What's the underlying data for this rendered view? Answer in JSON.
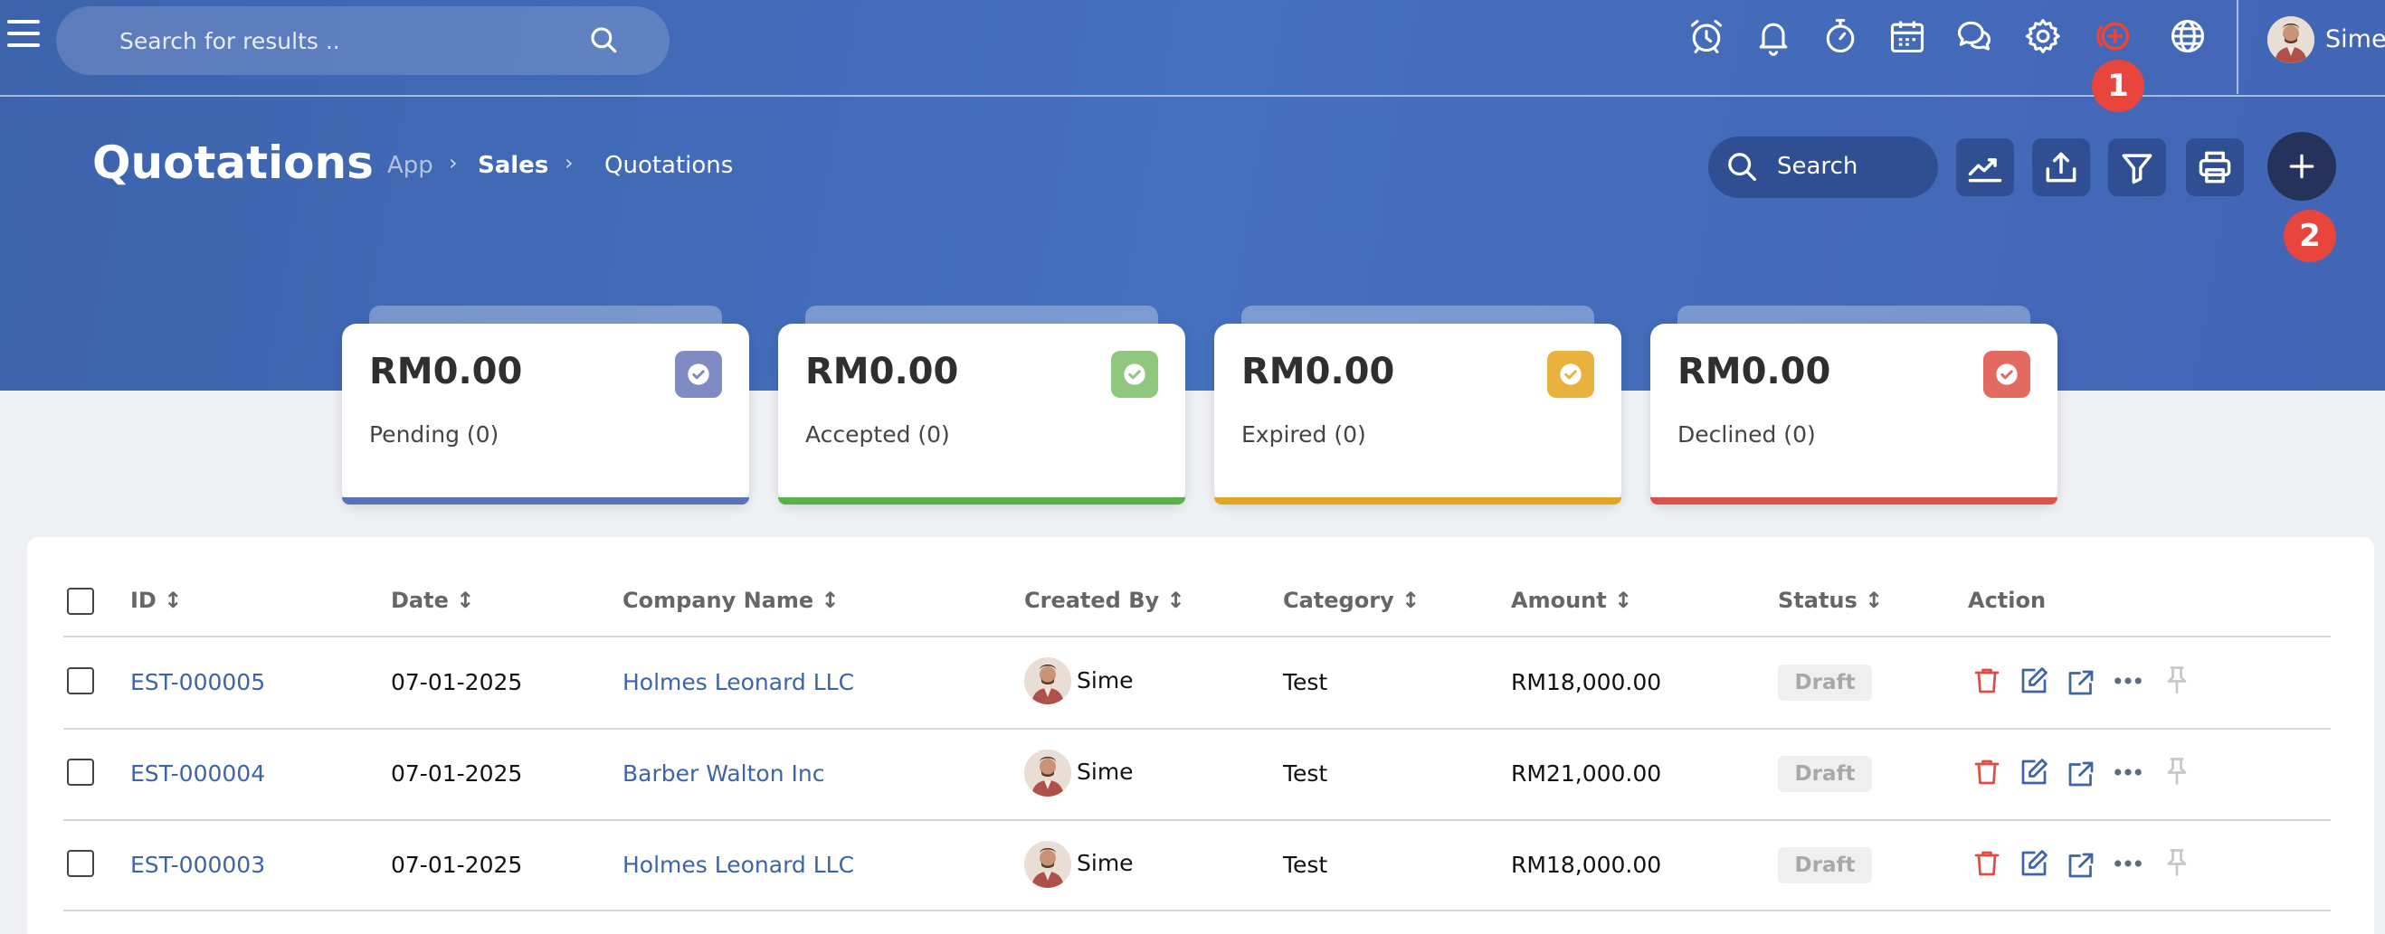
{
  "topbar": {
    "search_placeholder": "Search for results ..",
    "icons": [
      "alarm-icon",
      "bell-icon",
      "timer-icon",
      "calendar-icon",
      "chat-icon",
      "gear-icon",
      "add-circle-icon",
      "globe-icon"
    ],
    "user_name": "Sime",
    "callout_1": "1"
  },
  "page": {
    "title": "Quotations",
    "breadcrumb": [
      "App",
      "Sales",
      "Quotations"
    ],
    "search_label": "Search",
    "toolbar_icons": [
      "chart-icon",
      "upload-icon",
      "filter-icon",
      "print-icon",
      "plus-icon"
    ],
    "callout_2": "2"
  },
  "cards": [
    {
      "amount": "RM0.00",
      "label": "Pending (0)",
      "color": "#7f8cc4",
      "bar": "#5a72b8"
    },
    {
      "amount": "RM0.00",
      "label": "Accepted (0)",
      "color": "#8fc77e",
      "bar": "#5ab24a"
    },
    {
      "amount": "RM0.00",
      "label": "Expired (0)",
      "color": "#e9b23f",
      "bar": "#e2a625"
    },
    {
      "amount": "RM0.00",
      "label": "Declined (0)",
      "color": "#e36a60",
      "bar": "#d9534a"
    }
  ],
  "table": {
    "columns": [
      "ID ↕",
      "Date ↕",
      "Company Name ↕",
      "Created By ↕",
      "Category ↕",
      "Amount ↕",
      "Status ↕",
      "Action"
    ],
    "rows": [
      {
        "id": "EST-000005",
        "date": "07-01-2025",
        "company": "Holmes Leonard LLC",
        "created_by": "Sime",
        "category": "Test",
        "amount": "RM18,000.00",
        "status": "Draft"
      },
      {
        "id": "EST-000004",
        "date": "07-01-2025",
        "company": "Barber Walton Inc",
        "created_by": "Sime",
        "category": "Test",
        "amount": "RM21,000.00",
        "status": "Draft"
      },
      {
        "id": "EST-000003",
        "date": "07-01-2025",
        "company": "Holmes Leonard LLC",
        "created_by": "Sime",
        "category": "Test",
        "amount": "RM18,000.00",
        "status": "Draft"
      }
    ],
    "action_icons": [
      "trash-icon",
      "edit-icon",
      "external-link-icon",
      "more-icon",
      "pin-icon"
    ]
  },
  "colors": {
    "header_blue": "#4570bf",
    "link_blue": "#3d64a8",
    "callout_red": "#e8453c",
    "dark_button": "#24325c"
  }
}
